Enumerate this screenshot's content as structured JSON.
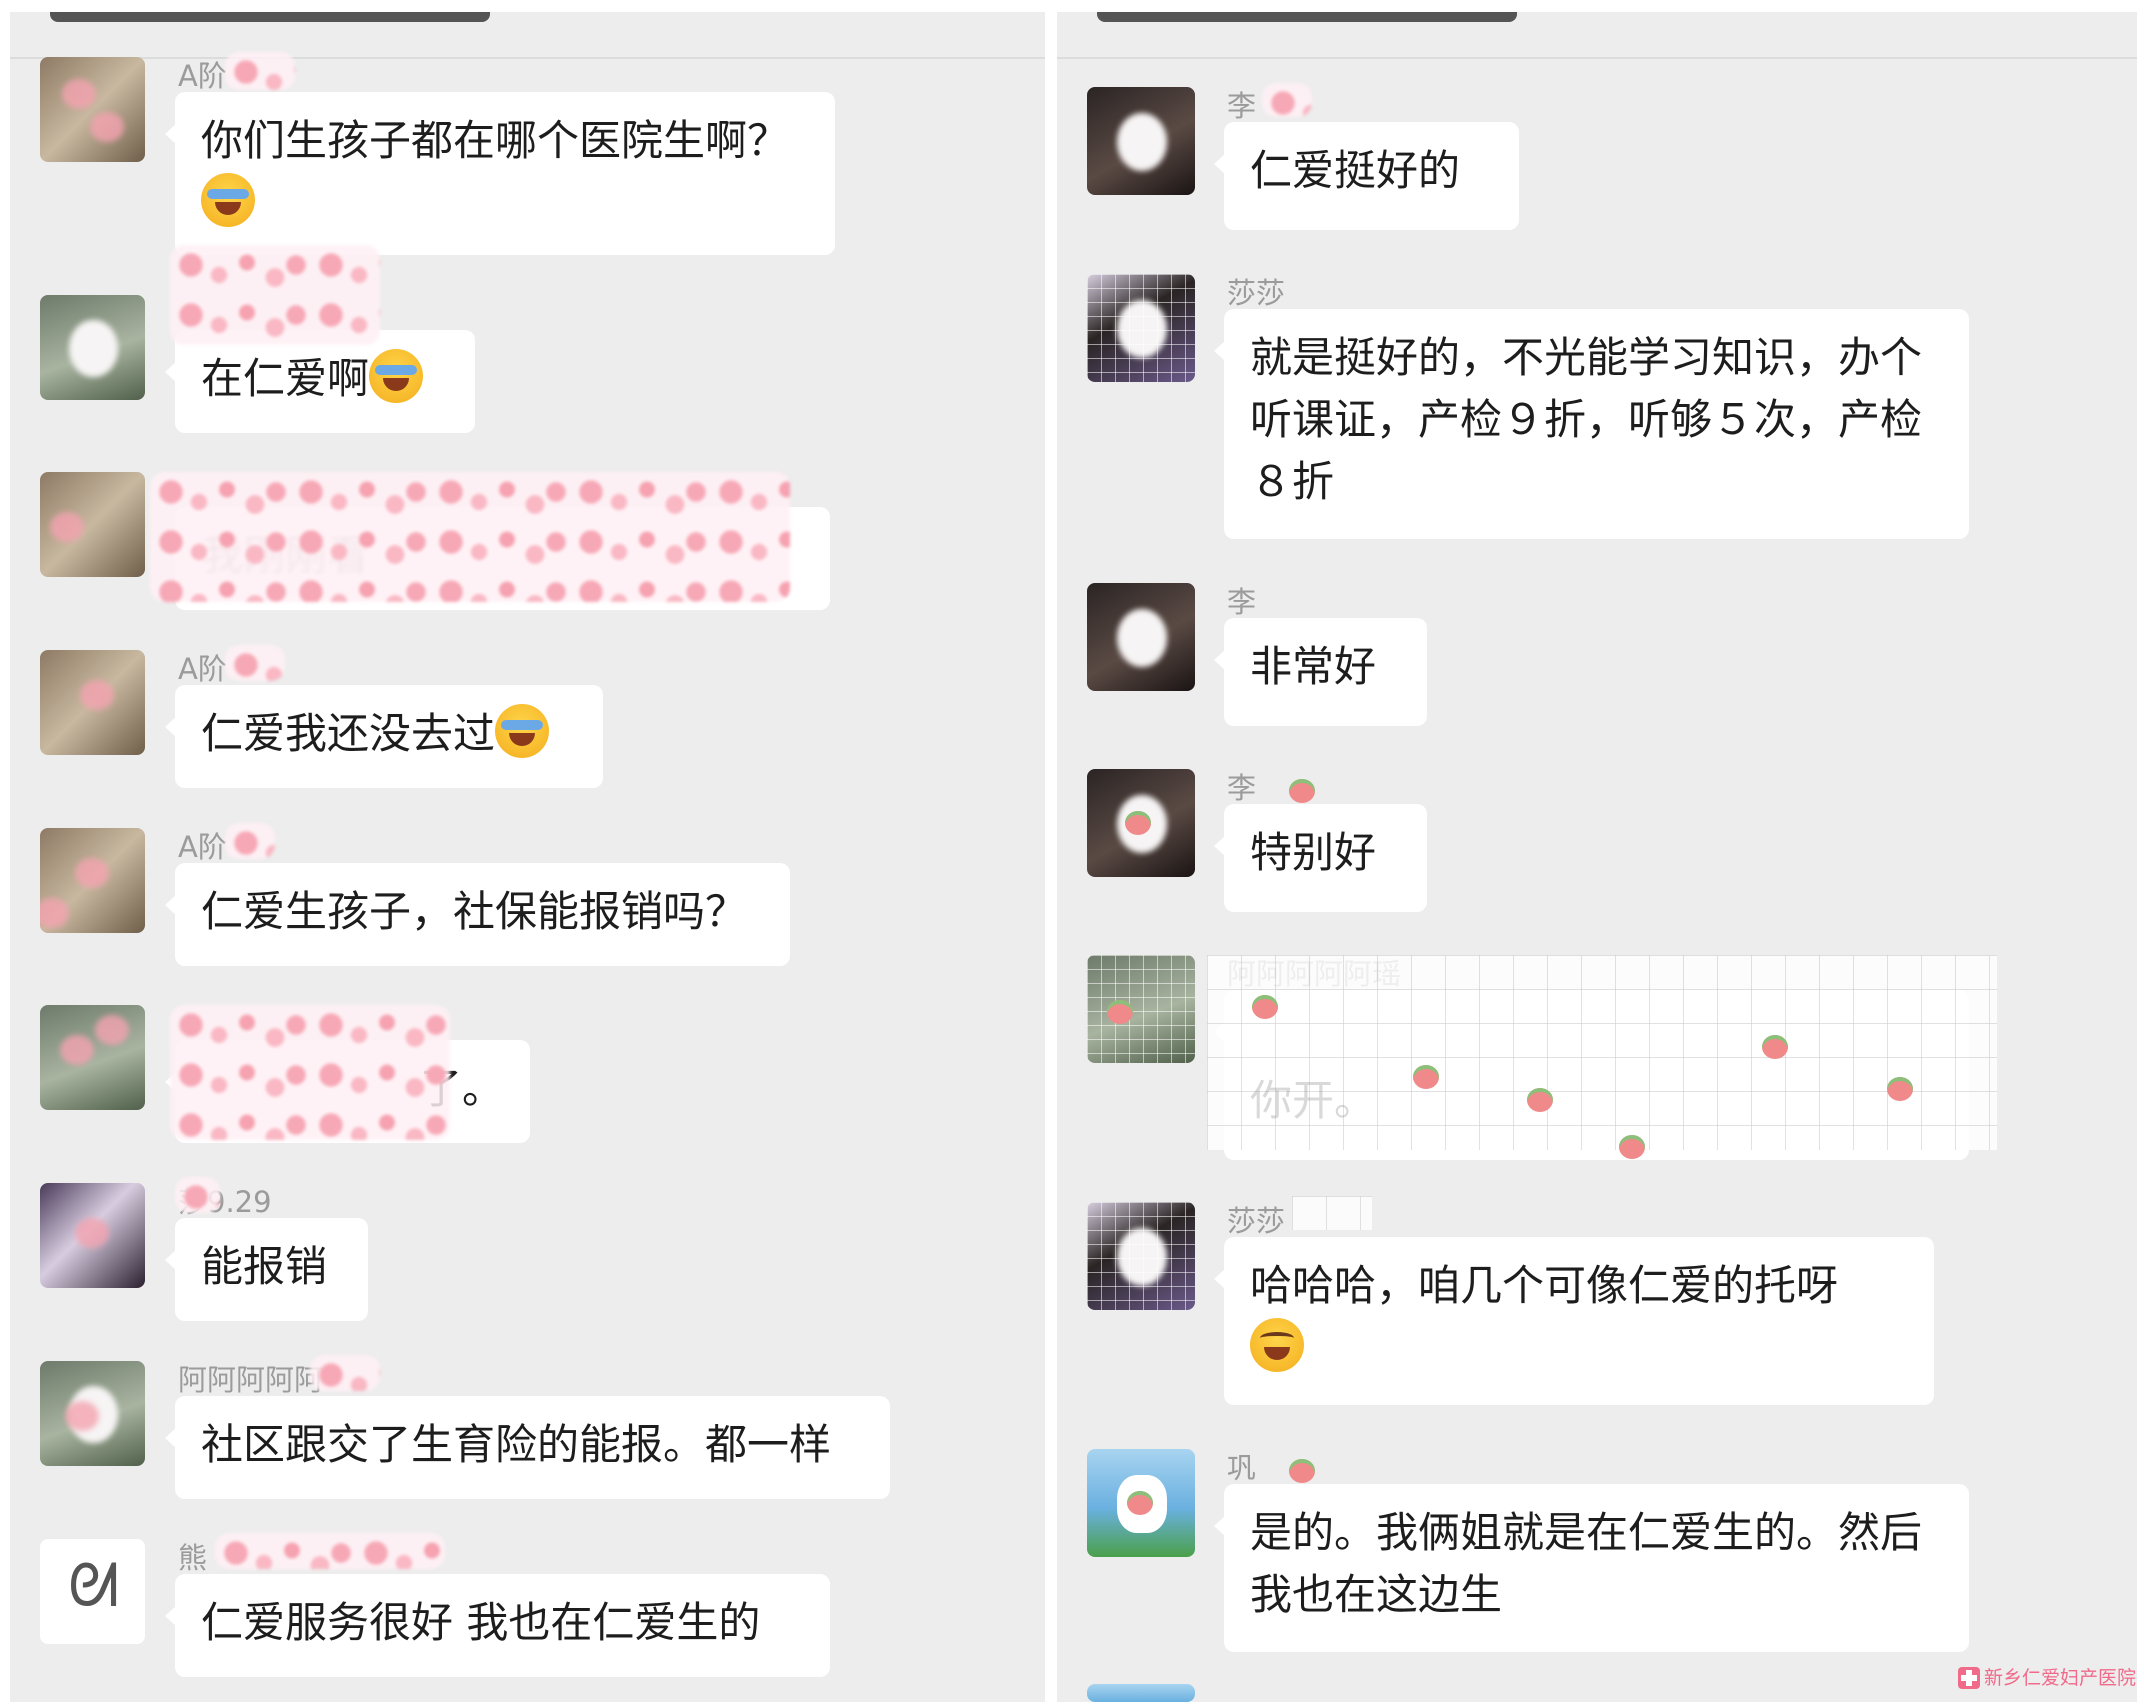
{
  "left_panel": {
    "messages": [
      {
        "sender": "A阶",
        "text": "你们生孩子都在哪个医院生啊？",
        "emoji": "cry-laugh-emoji"
      },
      {
        "sender": "",
        "text": "在仁爱啊",
        "emoji": "cry-laugh-emoji"
      },
      {
        "sender": "",
        "text": "我刚刚看",
        "emoji": ""
      },
      {
        "sender": "A阶",
        "text": "仁爱我还没去过",
        "emoji": "cry-laugh-emoji"
      },
      {
        "sender": "A阶",
        "text": "仁爱生孩子，社保能报销吗？",
        "emoji": ""
      },
      {
        "sender": "",
        "text": "了。",
        "emoji": ""
      },
      {
        "sender": "莎9.29",
        "text": "能报销",
        "emoji": ""
      },
      {
        "sender": "阿阿阿阿阿",
        "text": "社区跟交了生育险的能报。都一样",
        "emoji": ""
      },
      {
        "sender": "熊",
        "text": "仁爱服务很好 我也在仁爱生的",
        "emoji": ""
      }
    ]
  },
  "right_panel": {
    "messages": [
      {
        "sender": "李",
        "text": "仁爱挺好的",
        "emoji": ""
      },
      {
        "sender": "莎莎",
        "text": "就是挺好的，不光能学习知识，办个听课证，产检９折，听够５次，产检８折",
        "emoji": ""
      },
      {
        "sender": "李",
        "text": "非常好",
        "emoji": ""
      },
      {
        "sender": "李",
        "text": "特别好",
        "emoji": ""
      },
      {
        "sender": "阿阿阿阿阿瑶",
        "text": "你开。",
        "emoji": ""
      },
      {
        "sender": "莎莎",
        "text": "哈哈哈，咱几个可像仁爱的托呀",
        "emoji": "laugh-tears-emoji"
      },
      {
        "sender": "巩",
        "text": "是的。我俩姐就是在仁爱生的。然后我也在这边生",
        "emoji": ""
      }
    ]
  },
  "watermark": "新乡仁爱妇产医院",
  "colors": {
    "background": "#ededed",
    "bubble": "#ffffff",
    "sender_text": "#9b9b9b",
    "message_text": "#1d1d1d",
    "redaction_pink": "#f7a8b6",
    "watermark": "#f06a8a"
  }
}
